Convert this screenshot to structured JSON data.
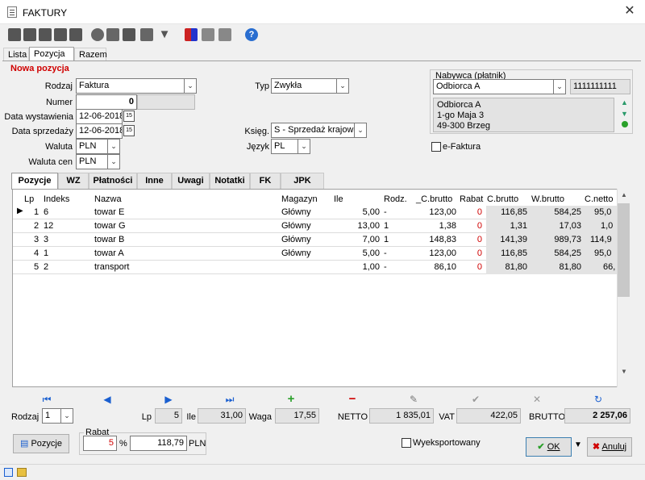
{
  "window": {
    "title": "FAKTURY",
    "close_icon": "close-icon"
  },
  "toolbar": {
    "icons": [
      "first-record-icon",
      "prev-record-icon",
      "add-record-icon",
      "delete-record-icon",
      "save-record-icon",
      "refresh-icon",
      "print-icon",
      "find-icon",
      "settings-icon",
      "filter-icon",
      "colors-icon",
      "copy-icon",
      "export-icon",
      "help-icon"
    ]
  },
  "main_tabs": [
    "Lista",
    "Pozycja",
    "Razem"
  ],
  "section_title": "Nowa pozycja",
  "form": {
    "rodzaj_label": "Rodzaj",
    "rodzaj_value": "Faktura",
    "numer_label": "Numer",
    "numer_value": "0",
    "data_wyst_label": "Data wystawienia",
    "data_wyst_value": "12-06-2018",
    "data_sprz_label": "Data sprzedaży",
    "data_sprz_value": "12-06-2018",
    "waluta_label": "Waluta",
    "waluta_value": "PLN",
    "waluta_cen_label": "Waluta cen",
    "waluta_cen_value": "PLN",
    "typ_label": "Typ",
    "typ_value": "Zwykła",
    "ksieg_label": "Księg.",
    "ksieg_value": "S - Sprzedaż krajowa",
    "jezyk_label": "Język",
    "jezyk_value": "PL"
  },
  "buyer": {
    "group_label": "Nabywca (płatnik)",
    "name": "Odbiorca A",
    "nip": "1111111111",
    "address": [
      "Odbiorca A",
      "1-go Maja 3",
      "49-300 Brzeg"
    ],
    "efaktura_label": "e-Faktura"
  },
  "sub_tabs": [
    "Pozycje",
    "WZ",
    "Płatności",
    "Inne",
    "Uwagi",
    "Notatki",
    "FK",
    "JPK"
  ],
  "grid": {
    "columns": [
      "Lp",
      "Indeks",
      "Nazwa",
      "Magazyn",
      "Ile",
      "Rodz.",
      "_C.brutto",
      "Rabat",
      "C.brutto",
      "W.brutto",
      "C.netto"
    ],
    "rows": [
      {
        "lp": "1",
        "indeks": "6",
        "nazwa": "towar E",
        "magazyn": "Główny",
        "ile": "5,00",
        "rodz": "-",
        "c_brutto_raw": "123,00",
        "rabat": "0",
        "c_brutto": "116,85",
        "w_brutto": "584,25",
        "c_netto": "95,0"
      },
      {
        "lp": "2",
        "indeks": "12",
        "nazwa": "towar G",
        "magazyn": "Główny",
        "ile": "13,00",
        "rodz": "1",
        "c_brutto_raw": "1,38",
        "rabat": "0",
        "c_brutto": "1,31",
        "w_brutto": "17,03",
        "c_netto": "1,0"
      },
      {
        "lp": "3",
        "indeks": "3",
        "nazwa": "towar B",
        "magazyn": "Główny",
        "ile": "7,00",
        "rodz": "1",
        "c_brutto_raw": "148,83",
        "rabat": "0",
        "c_brutto": "141,39",
        "w_brutto": "989,73",
        "c_netto": "114,9"
      },
      {
        "lp": "4",
        "indeks": "1",
        "nazwa": "towar A",
        "magazyn": "Główny",
        "ile": "5,00",
        "rodz": "-",
        "c_brutto_raw": "123,00",
        "rabat": "0",
        "c_brutto": "116,85",
        "w_brutto": "584,25",
        "c_netto": "95,0"
      },
      {
        "lp": "5",
        "indeks": "2",
        "nazwa": "transport",
        "magazyn": "",
        "ile": "1,00",
        "rodz": "-",
        "c_brutto_raw": "86,10",
        "rabat": "0",
        "c_brutto": "81,80",
        "w_brutto": "81,80",
        "c_netto": "66,"
      }
    ]
  },
  "summary": {
    "rodzaj_label": "Rodzaj",
    "rodzaj_value": "1",
    "lp_label": "Lp",
    "lp_value": "5",
    "ile_label": "Ile",
    "ile_value": "31,00",
    "waga_label": "Waga",
    "waga_value": "17,55",
    "netto_label": "NETTO",
    "netto_value": "1 835,01",
    "vat_label": "VAT",
    "vat_value": "422,05",
    "brutto_label": "BRUTTO",
    "brutto_value": "2 257,06"
  },
  "footer": {
    "pozycje_label": "Pozycje",
    "rabat_label": "Rabat",
    "rabat_pct": "5",
    "pct_sign": "%",
    "rabat_amount": "118,79",
    "currency": "PLN",
    "wyeksportowany_label": "Wyeksportowany",
    "ok_label": "OK",
    "anuluj_label": "Anuluj"
  },
  "colors": {
    "accent_red": "#d00000",
    "nav_blue": "#1a5fd0",
    "add_green": "#2aa02a"
  }
}
